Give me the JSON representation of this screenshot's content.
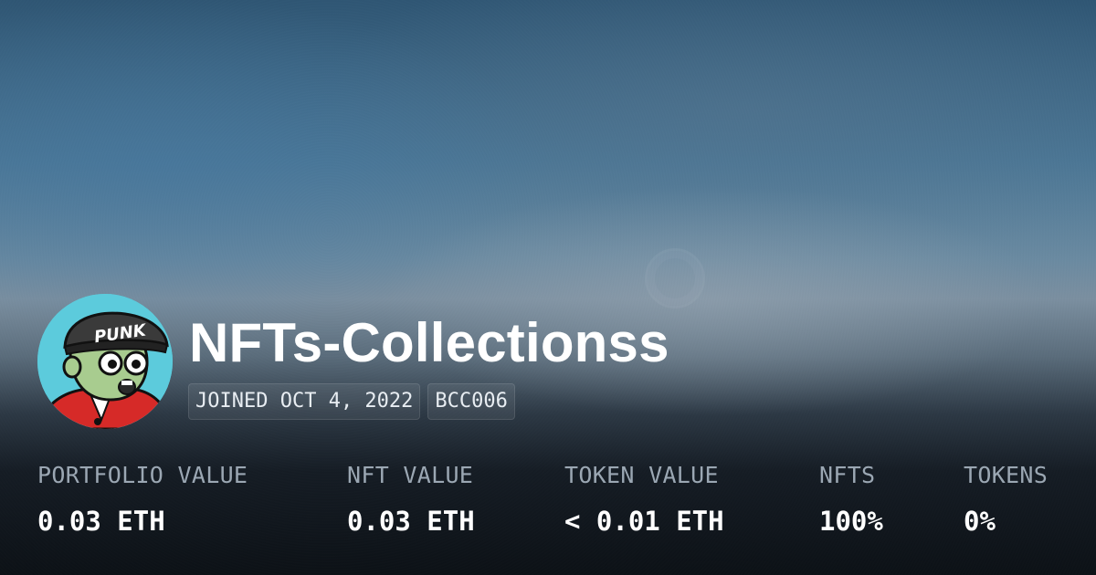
{
  "profile": {
    "name": "NFTs-Collectionss",
    "avatar_icon": "punk-character-avatar",
    "avatar_text": "PUNK",
    "tags": [
      "JOINED OCT 4, 2022",
      "BCC006"
    ]
  },
  "stats": [
    {
      "label": "PORTFOLIO VALUE",
      "value": "0.03 ETH"
    },
    {
      "label": "NFT VALUE",
      "value": "0.03 ETH"
    },
    {
      "label": "TOKEN VALUE",
      "value": "< 0.01 ETH"
    },
    {
      "label": "NFTS",
      "value": "100%"
    },
    {
      "label": "TOKENS",
      "value": "0%"
    }
  ],
  "colors": {
    "avatar_bg": "#5ccbdc",
    "label_gray": "#9ba7b3",
    "text_white": "#ffffff",
    "bg_dark": "#0c1116",
    "bg_blue": "#4a7695"
  }
}
